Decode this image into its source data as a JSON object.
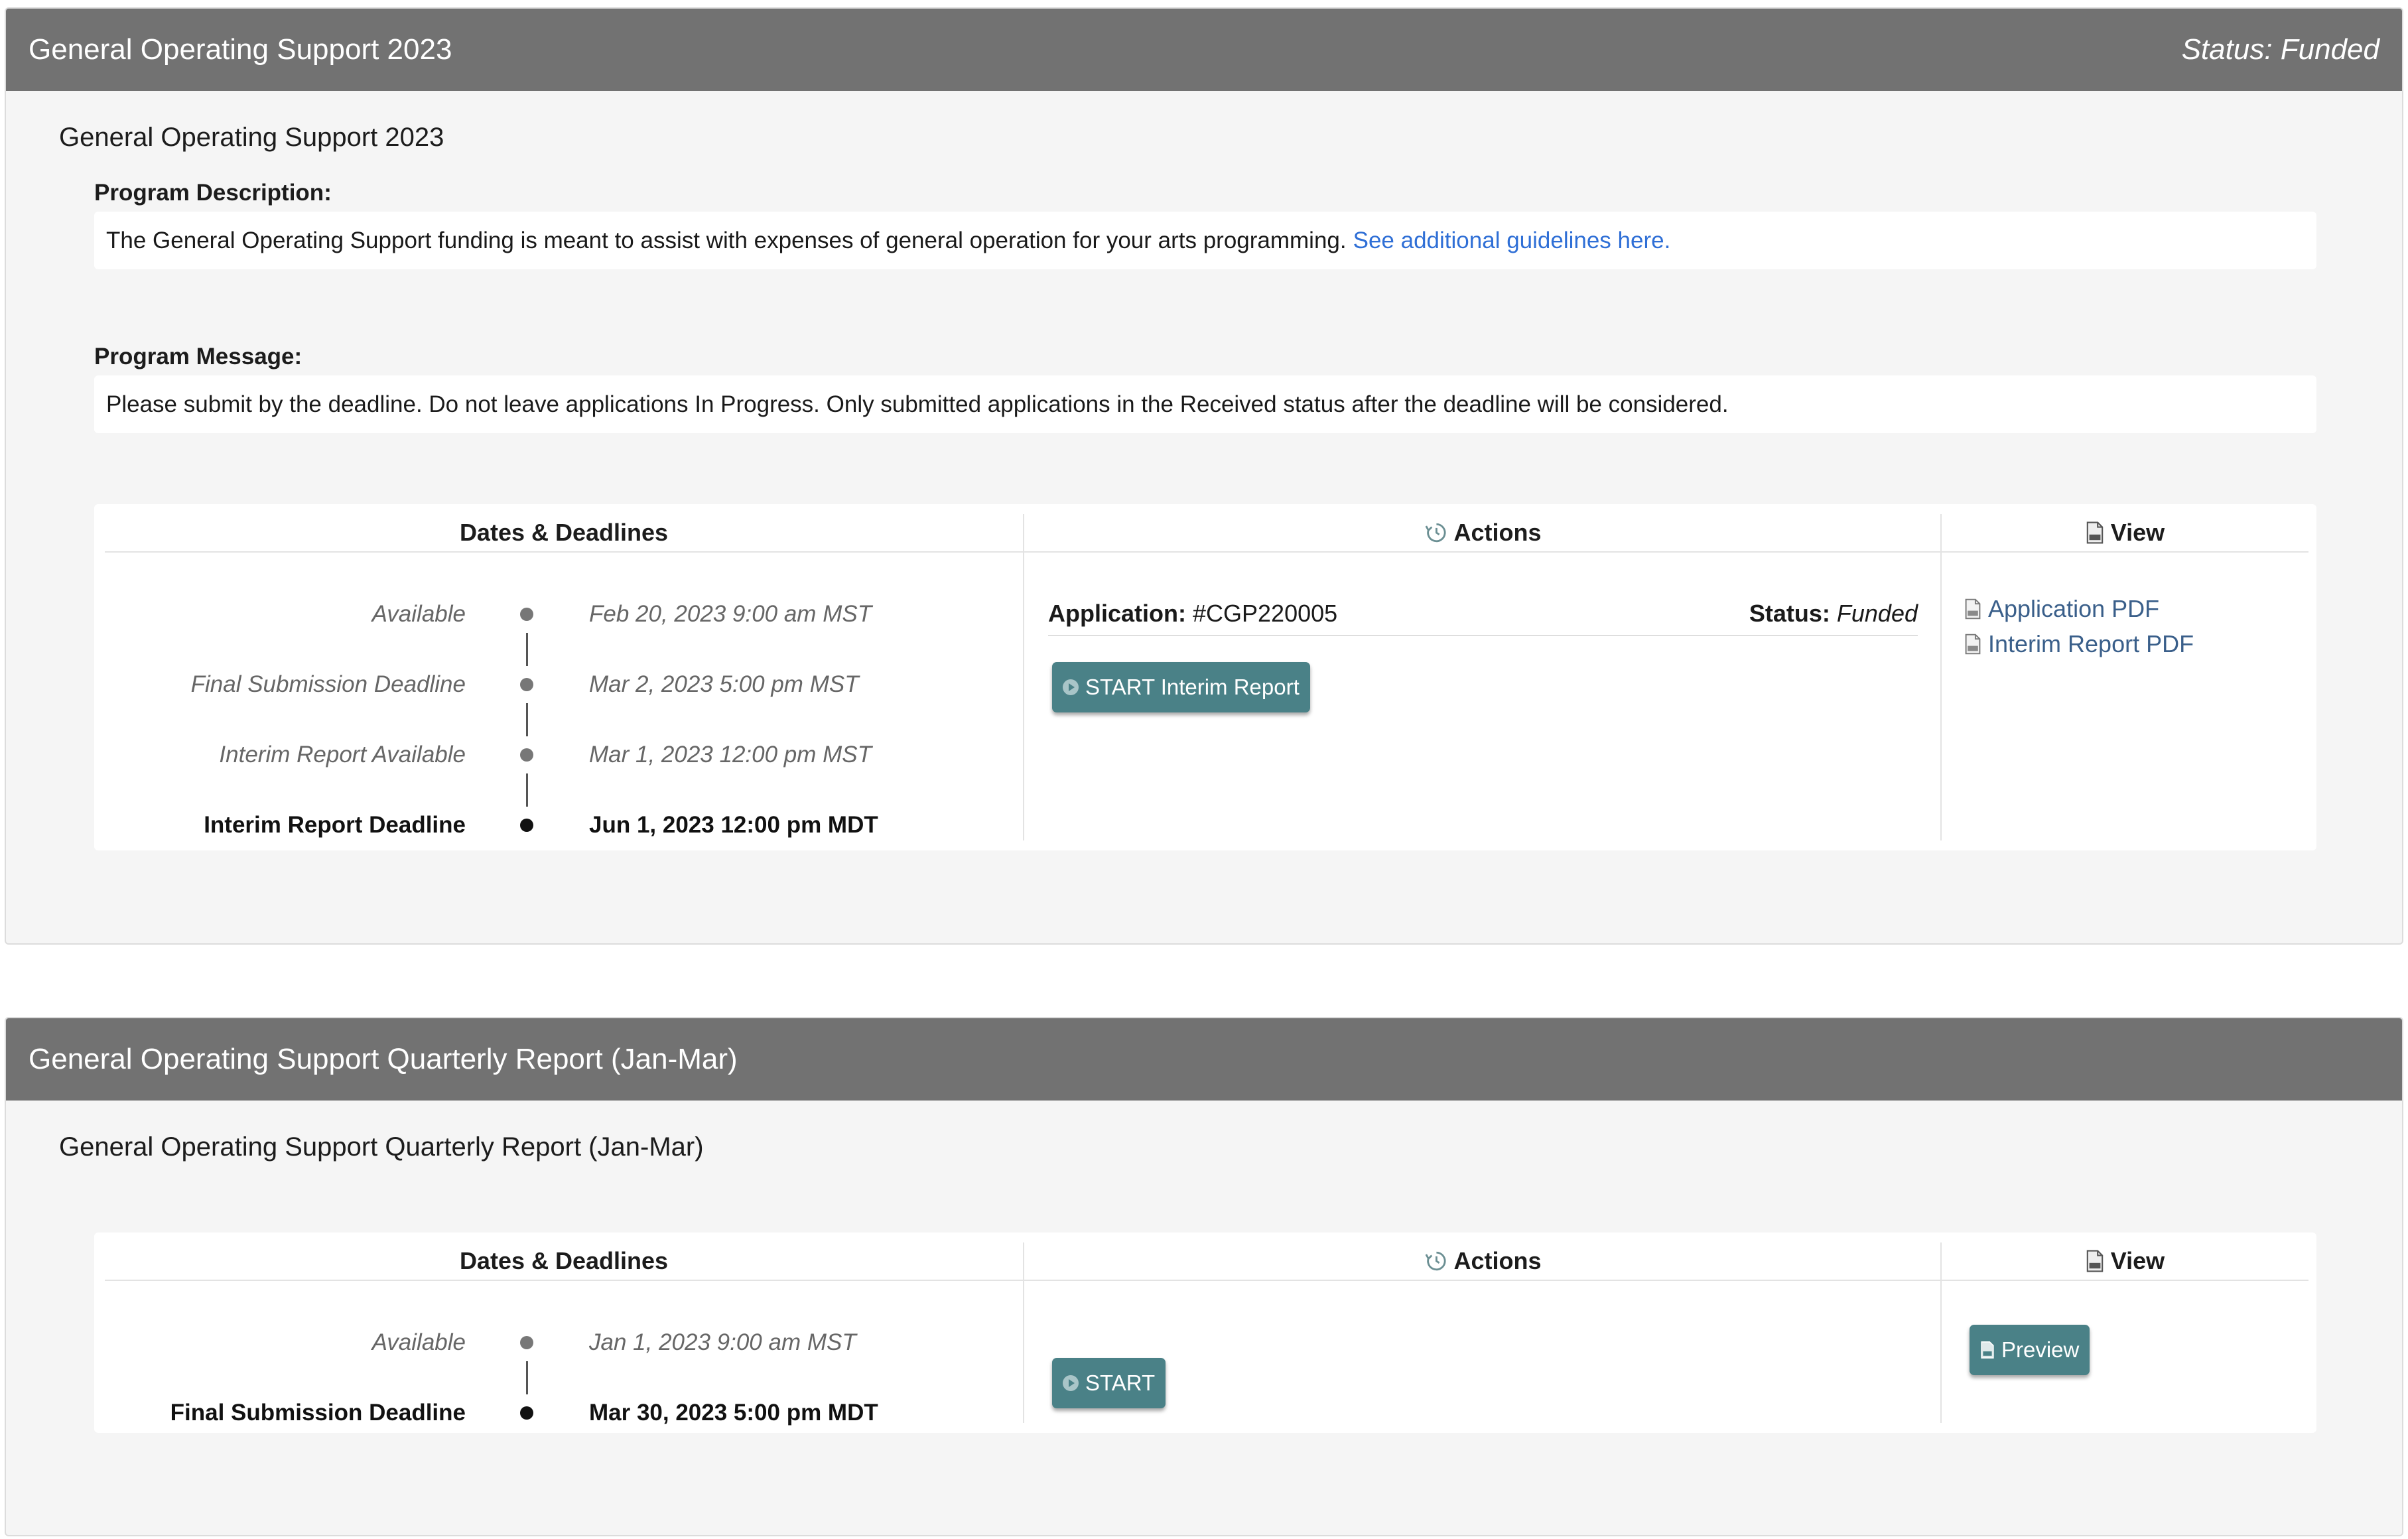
{
  "panel1": {
    "header_title": "General Operating Support 2023",
    "header_status": "Status: Funded",
    "program_title": "General Operating Support 2023",
    "description_label": "Program Description:",
    "description_text": "The General Operating Support funding is meant to assist with expenses of general operation for your arts programming.",
    "guidelines_link": "See additional guidelines here.",
    "message_label": "Program Message:",
    "message_text": "Please submit by the deadline. Do not leave applications In Progress. Only submitted applications in the Received status after the deadline will be considered.",
    "columns": {
      "dates": "Dates & Deadlines",
      "actions": "Actions",
      "view": "View"
    },
    "deadlines": [
      {
        "label": "Available",
        "date": "Feb 20, 2023 9:00 am MST"
      },
      {
        "label": "Final Submission Deadline",
        "date": "Mar 2, 2023 5:00 pm MST"
      },
      {
        "label": "Interim Report Available",
        "date": "Mar 1, 2023 12:00 pm MST"
      },
      {
        "label": "Interim Report Deadline",
        "date": "Jun 1, 2023 12:00 pm MDT"
      }
    ],
    "application_label": "Application:",
    "application_id": "#CGP220005",
    "status_label": "Status:",
    "status_value": "Funded",
    "start_button": "START Interim Report",
    "view_links": [
      "Application PDF",
      "Interim Report PDF"
    ]
  },
  "panel2": {
    "header_title": "General Operating Support Quarterly Report (Jan-Mar)",
    "program_title": "General Operating Support Quarterly Report (Jan-Mar)",
    "columns": {
      "dates": "Dates & Deadlines",
      "actions": "Actions",
      "view": "View"
    },
    "deadlines": [
      {
        "label": "Available",
        "date": "Jan 1, 2023 9:00 am MST"
      },
      {
        "label": "Final Submission Deadline",
        "date": "Mar 30, 2023 5:00 pm MDT"
      }
    ],
    "start_button": "START",
    "preview_button": "Preview"
  },
  "icons": {
    "actions": "history-icon",
    "view": "pdf-file-icon",
    "button": "play-circle-icon"
  },
  "colors": {
    "header_bg": "#727272",
    "button_bg": "#4a8187",
    "link": "#2f6fd6",
    "pdf_link": "#3a5f8a"
  }
}
